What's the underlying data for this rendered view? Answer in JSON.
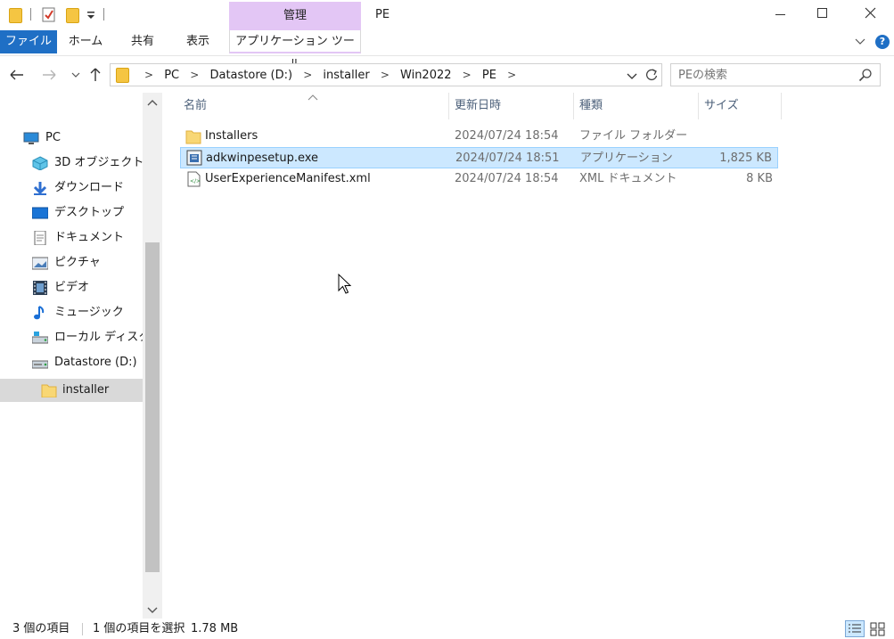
{
  "title_bar": {
    "context_tab_group": "管理",
    "window_title": "PE"
  },
  "ribbon": {
    "tabs": [
      {
        "label": "ファイル"
      },
      {
        "label": "ホーム"
      },
      {
        "label": "共有"
      },
      {
        "label": "表示"
      },
      {
        "label": "アプリケーション ツール"
      }
    ],
    "help_label": "?"
  },
  "address": {
    "breadcrumbs": [
      "PC",
      "Datastore (D:)",
      "installer",
      "Win2022",
      "PE"
    ],
    "separator": ">"
  },
  "search": {
    "placeholder": "PEの検索"
  },
  "sidebar": {
    "items": [
      {
        "label": "PC",
        "icon": "pc-icon"
      },
      {
        "label": "3D オブジェクト",
        "icon": "3d-objects-icon"
      },
      {
        "label": "ダウンロード",
        "icon": "download-icon"
      },
      {
        "label": "デスクトップ",
        "icon": "desktop-icon"
      },
      {
        "label": "ドキュメント",
        "icon": "documents-icon"
      },
      {
        "label": "ピクチャ",
        "icon": "pictures-icon"
      },
      {
        "label": "ビデオ",
        "icon": "videos-icon"
      },
      {
        "label": "ミュージック",
        "icon": "music-icon"
      },
      {
        "label": "ローカル ディスク (C",
        "icon": "local-disk-icon"
      },
      {
        "label": "Datastore (D:)",
        "icon": "drive-icon"
      },
      {
        "label": "installer",
        "icon": "folder-icon",
        "selected": true
      }
    ]
  },
  "file_list": {
    "columns": [
      "名前",
      "更新日時",
      "種類",
      "サイズ"
    ],
    "rows": [
      {
        "name": "Installers",
        "date": "2024/07/24 18:54",
        "type": "ファイル フォルダー",
        "size": "",
        "icon": "folder-icon"
      },
      {
        "name": "adkwinpesetup.exe",
        "date": "2024/07/24 18:51",
        "type": "アプリケーション",
        "size": "1,825 KB",
        "icon": "exe-icon",
        "selected": true
      },
      {
        "name": "UserExperienceManifest.xml",
        "date": "2024/07/24 18:54",
        "type": "XML ドキュメント",
        "size": "8 KB",
        "icon": "xml-icon"
      }
    ]
  },
  "status_bar": {
    "item_count": "3 個の項目",
    "selection": "1 個の項目を選択",
    "selection_size": "1.78 MB"
  },
  "colors": {
    "file_tab": "#1f6fc5",
    "context_tab": "#e3c6f5",
    "selection_bg": "#cce8ff",
    "selection_border": "#99d1ff",
    "column_header_text": "#4c607a"
  }
}
